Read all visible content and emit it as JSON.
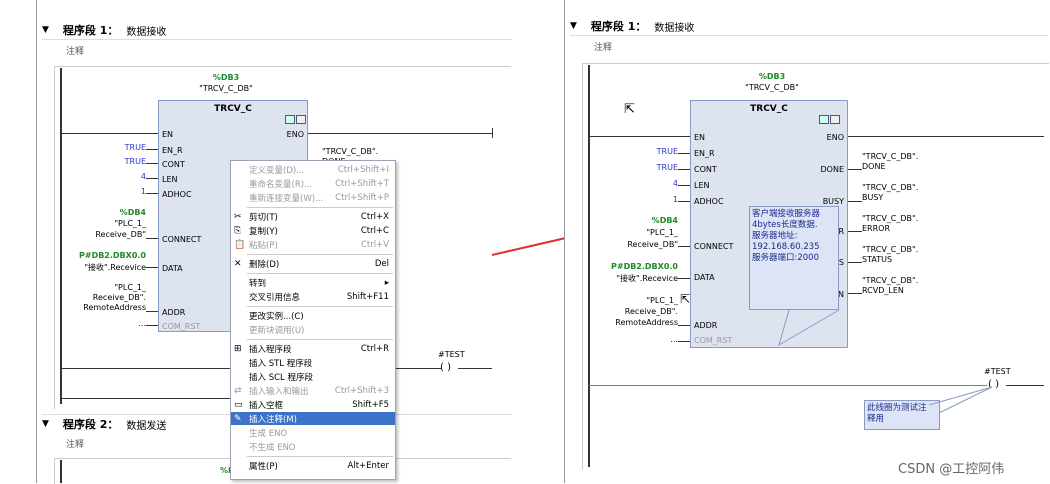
{
  "left": {
    "segment1": {
      "label": "程序段 1：",
      "name": "数据接收",
      "comment": "注释"
    },
    "segment2": {
      "label": "程序段 2：",
      "name": "数据发送",
      "comment": "注释"
    },
    "db_ref": "%DB3",
    "db_name": "\"TRCV_C_DB\"",
    "block_type": "TRCV_C",
    "pins_in": [
      "EN",
      "EN_R",
      "CONT",
      "LEN",
      "ADHOC",
      "CONNECT",
      "DATA",
      "ADDR",
      "COM_RST"
    ],
    "pin_out_eno": "ENO",
    "inputs": {
      "en_r": "TRUE",
      "cont": "TRUE",
      "len": "4",
      "adhoc": "1",
      "connect_db": "%DB4",
      "connect_name1": "\"PLC_1_",
      "connect_name2": "Receive_DB\"",
      "data_addr": "P#DB2.DBX0.0",
      "data_name": "\"接收\".Recevice",
      "addr_line1": "\"PLC_1_",
      "addr_line2": "Receive_DB\".",
      "addr_line3": "RemoteAddress",
      "com_rst": "..."
    },
    "out_done_partial1": "\"TRCV_C_DB\".",
    "out_done_partial2": "DONE",
    "bottom_db_partial": "%D",
    "test_label": "#TEST",
    "context_menu": [
      {
        "label": "定义变量(D)...",
        "shortcut": "Ctrl+Shift+I",
        "enabled": false
      },
      {
        "label": "重命名变量(R)...",
        "shortcut": "Ctrl+Shift+T",
        "enabled": false
      },
      {
        "label": "重新连接变量(W)...",
        "shortcut": "Ctrl+Shift+P",
        "enabled": false
      },
      {
        "label": "剪切(T)",
        "shortcut": "Ctrl+X",
        "enabled": true,
        "icon": "scissors-icon"
      },
      {
        "label": "复制(Y)",
        "shortcut": "Ctrl+C",
        "enabled": true,
        "icon": "copy-icon"
      },
      {
        "label": "粘贴(P)",
        "shortcut": "Ctrl+V",
        "enabled": false,
        "icon": "paste-icon"
      },
      {
        "label": "删除(D)",
        "shortcut": "Del",
        "enabled": true,
        "icon": "delete-icon"
      },
      {
        "label": "转到",
        "shortcut": "▸",
        "enabled": true
      },
      {
        "label": "交叉引用信息",
        "shortcut": "Shift+F11",
        "enabled": true
      },
      {
        "label": "更改实例...(C)",
        "shortcut": "",
        "enabled": true
      },
      {
        "label": "更新块调用(U)",
        "shortcut": "",
        "enabled": false
      },
      {
        "label": "插入程序段",
        "shortcut": "Ctrl+R",
        "enabled": true,
        "icon": "insert-network-icon"
      },
      {
        "label": "插入 STL 程序段",
        "shortcut": "",
        "enabled": true
      },
      {
        "label": "插入 SCL 程序段",
        "shortcut": "",
        "enabled": true
      },
      {
        "label": "插入输入和输出",
        "shortcut": "Ctrl+Shift+3",
        "enabled": false,
        "icon": "io-icon"
      },
      {
        "label": "插入空框",
        "shortcut": "Shift+F5",
        "enabled": true,
        "icon": "empty-box-icon"
      },
      {
        "label": "插入注释(M)",
        "shortcut": "",
        "enabled": true,
        "selected": true,
        "icon": "comment-icon"
      },
      {
        "label": "生成 ENO",
        "shortcut": "",
        "enabled": false
      },
      {
        "label": "不生成 ENO",
        "shortcut": "",
        "enabled": false
      },
      {
        "label": "属性(P)",
        "shortcut": "Alt+Enter",
        "enabled": true
      }
    ]
  },
  "right": {
    "segment1": {
      "label": "程序段 1：",
      "name": "数据接收",
      "comment": "注释"
    },
    "db_ref": "%DB3",
    "db_name": "\"TRCV_C_DB\"",
    "block_type": "TRCV_C",
    "pins_in": [
      "EN",
      "EN_R",
      "CONT",
      "LEN",
      "ADHOC",
      "CONNECT",
      "DATA",
      "ADDR",
      "COM_RST"
    ],
    "pins_out": [
      "ENO",
      "DONE",
      "BUSY",
      "ERROR",
      "STATUS",
      "RCVD_LEN"
    ],
    "pins_out_partial": [
      "BUSY",
      "R",
      "US",
      "N"
    ],
    "outputs": [
      {
        "line1": "\"TRCV_C_DB\".",
        "line2": "DONE"
      },
      {
        "line1": "\"TRCV_C_DB\".",
        "line2": "BUSY"
      },
      {
        "line1": "\"TRCV_C_DB\".",
        "line2": "ERROR"
      },
      {
        "line1": "\"TRCV_C_DB\".",
        "line2": "STATUS"
      },
      {
        "line1": "\"TRCV_C_DB\".",
        "line2": "RCVD_LEN"
      }
    ],
    "inputs": {
      "en_r": "TRUE",
      "cont": "TRUE",
      "len": "4",
      "adhoc": "1",
      "connect_db": "%DB4",
      "connect_name1": "\"PLC_1_",
      "connect_name2": "Receive_DB\"",
      "data_addr": "P#DB2.DBX0.0",
      "data_name": "\"接收\".Recevice",
      "addr_line1": "\"PLC_1_",
      "addr_line2": "Receive_DB\".",
      "addr_line3": "RemoteAddress",
      "com_rst": "..."
    },
    "comment_box": [
      "客户端接收服务器",
      "4bytes长度数据.",
      "服务器地址:",
      "192.168.60.235",
      "服务器端口:2000"
    ],
    "test_label": "#TEST",
    "coil_comment": [
      "此线圈为测试注",
      "释用"
    ]
  },
  "watermark": "CSDN @工控阿伟",
  "colors": {
    "accent_arrow": "#e23030",
    "block_fill": "#dde4f0",
    "selection": "#3c72c8"
  }
}
